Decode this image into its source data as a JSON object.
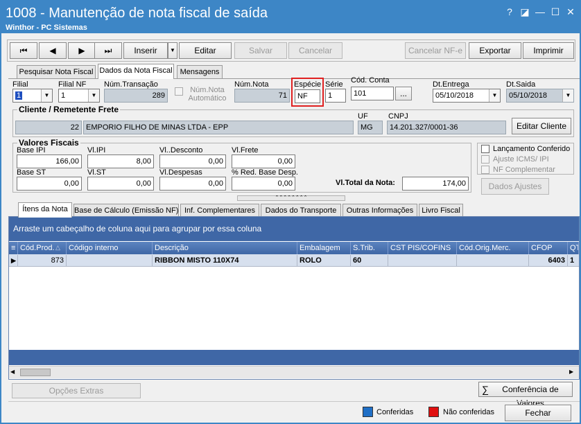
{
  "window": {
    "title": "1008 - Manutenção de nota fiscal de saída",
    "subtitle": "Winthor - PC Sistemas",
    "help": "?",
    "restore": "◪",
    "minimize": "—",
    "maximize": "☐",
    "close": "✕"
  },
  "toolbar": {
    "first": "⏮",
    "prev": "◀",
    "next": "▶",
    "last": "⏭",
    "inserir": "Inserir",
    "editar": "Editar",
    "salvar": "Salvar",
    "cancelar": "Cancelar",
    "cancelar_nfe": "Cancelar NF-e",
    "exportar": "Exportar",
    "imprimir": "Imprimir"
  },
  "tabs": [
    "Pesquisar Nota Fiscal",
    "Dados da Nota Fiscal",
    "Mensagens"
  ],
  "form": {
    "filial_label": "Filial",
    "filial_value": "1",
    "filial_nf_label": "Filial NF",
    "filial_nf_value": "1",
    "num_transacao_label": "Núm.Transação",
    "num_transacao_value": "289",
    "num_nota_auto_label": "Núm.Nota Automático",
    "num_nota_label": "Núm.Nota",
    "num_nota_value": "71",
    "especie_label": "Espécie",
    "especie_value": "NF",
    "serie_label": "Série",
    "serie_value": "1",
    "cod_conta_label": "Cód. Conta",
    "cod_conta_value": "101",
    "cod_conta_btn": "...",
    "dt_entrega_label": "Dt.Entrega",
    "dt_entrega_value": "05/10/2018",
    "dt_saida_label": "Dt.Saida",
    "dt_saida_value": "05/10/2018"
  },
  "cliente": {
    "group_title": "Cliente / Remetente Frete",
    "code": "22",
    "name": "EMPORIO FILHO DE MINAS LTDA - EPP",
    "uf_label": "UF",
    "uf_value": "MG",
    "cnpj_label": "CNPJ",
    "cnpj_value": "14.201.327/0001-36",
    "editar_btn": "Editar Cliente"
  },
  "fiscais": {
    "group_title": "Valores Fiscais",
    "base_ipi_label": "Base IPI",
    "base_ipi": "166,00",
    "vl_ipi_label": "Vl.IPI",
    "vl_ipi": "8,00",
    "vl_desconto_label": "Vl..Desconto",
    "vl_desconto": "0,00",
    "vl_frete_label": "Vl.Frete",
    "vl_frete": "0,00",
    "base_st_label": "Base ST",
    "base_st": "0,00",
    "vl_st_label": "Vl.ST",
    "vl_st": "0,00",
    "vl_despesas_label": "Vl.Despesas",
    "vl_despesas": "0,00",
    "red_base_label": "% Red. Base Desp.",
    "red_base": "0,00",
    "total_label": "Vl.Total da Nota:",
    "total": "174,00"
  },
  "checks": {
    "lancamento": "Lançamento Conferido",
    "ajuste": "Ajuste ICMS/ IPI",
    "nf_compl": "NF Complementar",
    "dados_ajustes": "Dados Ajustes"
  },
  "inner_tabs": [
    "Ítens da Nota",
    "Base de Cálculo (Emissão NF)",
    "Inf. Complementares",
    "Dados do Transporte",
    "Outras Informações",
    "Livro Fiscal"
  ],
  "grid": {
    "group_hint": "Arraste um cabeçalho de coluna aqui para agrupar por essa coluna",
    "columns": [
      "Cód.Prod.",
      "Código interno",
      "Descrição",
      "Embalagem",
      "S.Trib.",
      "CST PIS/COFINS",
      "Cód.Orig.Merc.",
      "CFOP",
      "QT"
    ],
    "rows": [
      [
        "873",
        "",
        "RIBBON MISTO 110X74",
        "ROLO",
        "60",
        "",
        "",
        "6403",
        "1"
      ]
    ]
  },
  "bottom": {
    "opcoes": "Opções Extras",
    "conferencia": "Conferência de Valores",
    "legend_conferidas": "Conferidas",
    "legend_nao": "Não conferidas",
    "fechar": "Fechar",
    "sigma": "∑"
  },
  "colors": {
    "title_bar": "#3d86c6",
    "grid_header": "#4a70b0",
    "highlight": "#e02020",
    "conferidas": "#1f6fc6",
    "nao_conferidas": "#e01010"
  }
}
